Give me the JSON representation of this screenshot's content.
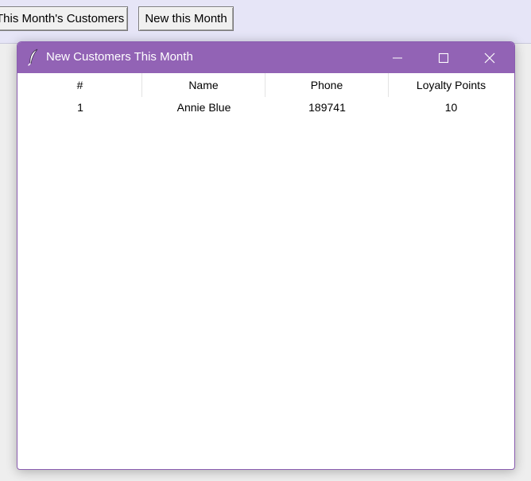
{
  "parent_toolbar": {
    "buttons": [
      {
        "label": "This Month's Customers"
      },
      {
        "label": "New this Month"
      }
    ]
  },
  "window": {
    "title": "New Customers This Month",
    "icon": "feather-icon",
    "controls": [
      "minimize-icon",
      "maximize-icon",
      "close-icon"
    ]
  },
  "table": {
    "columns": [
      "#",
      "Name",
      "Phone",
      "Loyalty Points"
    ],
    "rows": [
      {
        "num": "1",
        "name": "Annie Blue",
        "phone": "189741",
        "points": "10"
      }
    ]
  },
  "colors": {
    "titlebar": "#9263b5",
    "window_border": "#8a5db0",
    "toolbar_bg": "#e6e5f7"
  }
}
